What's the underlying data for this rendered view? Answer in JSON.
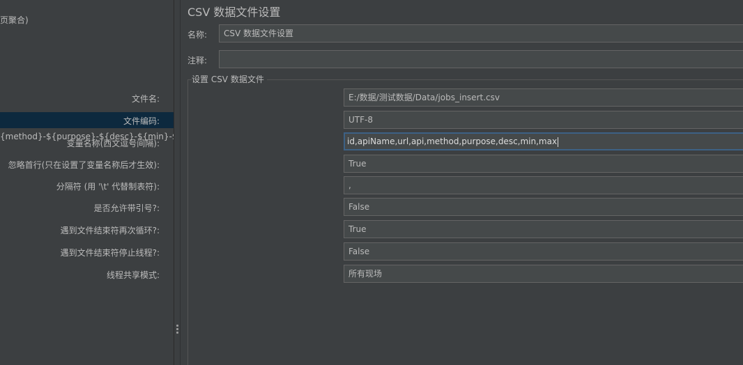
{
  "tree": {
    "item_partial_1": "页聚合)",
    "item_partial_2": "{method}-${purpose}-${desc}-${min}-${max}"
  },
  "panel": {
    "title": "CSV 数据文件设置",
    "name_label": "名称:",
    "name_value": "CSV 数据文件设置",
    "comment_label": "注释:",
    "comment_value": "",
    "group_title": "设置 CSV 数据文件"
  },
  "fields": [
    {
      "label": "文件名:",
      "value": "E:/数据/测试数据/Data/jobs_insert.csv"
    },
    {
      "label": "文件编码:",
      "value": "UTF-8"
    },
    {
      "label": "变量名称(西文逗号间隔):",
      "value": "id,apiName,url,api,method,purpose,desc,min,max"
    },
    {
      "label": "忽略首行(只在设置了变量名称后才生效):",
      "value": "True"
    },
    {
      "label": "分隔符 (用 '\\t' 代替制表符):",
      "value": ","
    },
    {
      "label": "是否允许带引号?:",
      "value": "False"
    },
    {
      "label": "遇到文件结束符再次循环?:",
      "value": "True"
    },
    {
      "label": "遇到文件结束符停止线程?:",
      "value": "False"
    },
    {
      "label": "线程共享模式:",
      "value": "所有现场"
    }
  ]
}
